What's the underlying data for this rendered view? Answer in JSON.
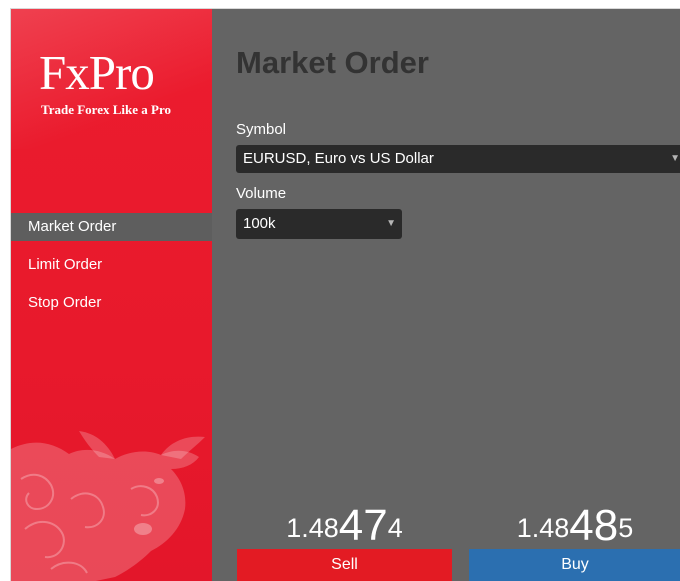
{
  "brand": {
    "logo_text": "FxPro",
    "tagline": "Trade Forex Like a Pro"
  },
  "nav": {
    "items": [
      {
        "label": "Market Order",
        "active": true
      },
      {
        "label": "Limit Order",
        "active": false
      },
      {
        "label": "Stop Order",
        "active": false
      }
    ]
  },
  "main": {
    "title": "Market Order",
    "symbol_label": "Symbol",
    "symbol_value": "EURUSD, Euro vs US Dollar",
    "volume_label": "Volume",
    "volume_value": "100k"
  },
  "quotes": {
    "sell": {
      "prefix": "1.48",
      "big": "47",
      "pip": "4"
    },
    "buy": {
      "prefix": "1.48",
      "big": "48",
      "pip": "5"
    }
  },
  "buttons": {
    "sell_label": "Sell",
    "buy_label": "Buy"
  },
  "colors": {
    "brand_red": "#e8192c",
    "panel_gray": "#646464",
    "sell_red": "#e31b23",
    "buy_blue": "#2b6fb0"
  },
  "icons": {
    "dropdown": "chevron-down-icon",
    "emblem": "bull-icon"
  }
}
